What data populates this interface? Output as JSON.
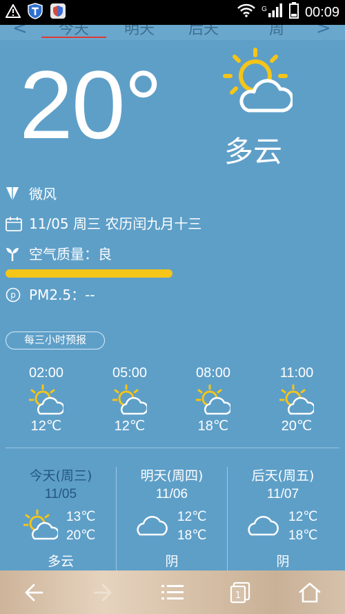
{
  "status_bar": {
    "time": "00:09",
    "network_type": "G"
  },
  "tabs": [
    {
      "label": "今天",
      "selected": true
    },
    {
      "label": "明天",
      "selected": false
    },
    {
      "label": "后天",
      "selected": false
    },
    {
      "label": "周",
      "selected": false
    }
  ],
  "current": {
    "temperature": "20°",
    "condition": "多云",
    "wind": "微风",
    "date_line": "11/05 周三 农历闰九月十三",
    "air_quality": "空气质量：良",
    "air_quality_level": 0.5,
    "pm25": "PM2.5：--"
  },
  "hourly": {
    "label": "每三小时预报",
    "items": [
      {
        "time": "02:00",
        "temp": "12℃",
        "icon": "partly-cloudy-icon"
      },
      {
        "time": "05:00",
        "temp": "12℃",
        "icon": "partly-cloudy-icon"
      },
      {
        "time": "08:00",
        "temp": "18℃",
        "icon": "partly-cloudy-icon"
      },
      {
        "time": "11:00",
        "temp": "20℃",
        "icon": "partly-cloudy-icon"
      }
    ]
  },
  "daily": [
    {
      "name": "今天(周三)",
      "date": "11/05",
      "high": "13℃",
      "low": "20℃",
      "condition": "多云",
      "icon": "partly-cloudy-icon"
    },
    {
      "name": "明天(周四)",
      "date": "11/06",
      "high": "12℃",
      "low": "18℃",
      "condition": "阴",
      "icon": "cloud-icon"
    },
    {
      "name": "后天(周五)",
      "date": "11/07",
      "high": "12℃",
      "low": "18℃",
      "condition": "阴",
      "icon": "cloud-icon"
    }
  ],
  "colors": {
    "background": "#5e9fc8",
    "accent_underline": "#e03a32",
    "aqi_bar": "#f5c518",
    "sun": "#f5c518"
  }
}
